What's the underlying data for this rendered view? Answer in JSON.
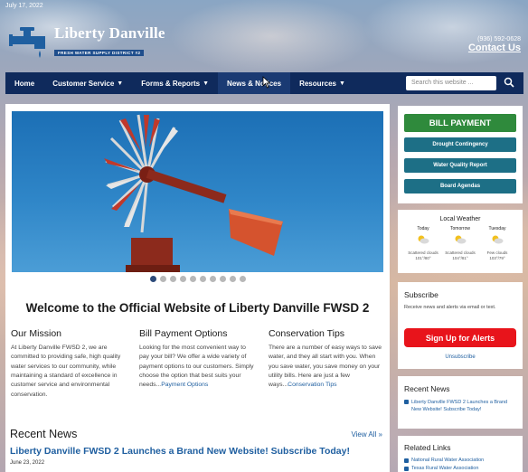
{
  "header": {
    "date": "July 17, 2022",
    "logo_title": "Liberty Danville",
    "logo_subtitle": "FRESH WATER SUPPLY DISTRICT #2",
    "phone": "(936) 592-0628",
    "contact_label": "Contact Us"
  },
  "nav": {
    "items": [
      {
        "label": "Home",
        "dropdown": false
      },
      {
        "label": "Customer Service",
        "dropdown": true
      },
      {
        "label": "Forms & Reports",
        "dropdown": true
      },
      {
        "label": "News & Notices",
        "dropdown": false
      },
      {
        "label": "Resources",
        "dropdown": true
      }
    ],
    "search_placeholder": "Search this website ..."
  },
  "main": {
    "slider_dots": 10,
    "slider_active": 0,
    "welcome": "Welcome to the Official Website of Liberty Danville FWSD 2",
    "columns": [
      {
        "title": "Our Mission",
        "text": "At Liberty Danville FWSD 2, we are committed to providing safe, high quality water services to our community, while maintaining a standard of excellence in customer service and environmental conservation.",
        "link": ""
      },
      {
        "title": "Bill Payment Options",
        "text": "Looking for the most convenient way to pay your bill? We offer a wide variety of payment options to our customers. Simply choose the option that best suits your needs...",
        "link": "Payment Options"
      },
      {
        "title": "Conservation Tips",
        "text": "There are a number of easy ways to save water, and they all start with you. When you save water, you save money on your utility bills. Here are just a few ways...",
        "link": "Conservation Tips"
      }
    ],
    "recent_news": {
      "title": "Recent News",
      "view_all": "View All »",
      "headline": "Liberty Danville FWSD 2 Launches a Brand New Website! Subscribe Today!",
      "date": "June 23, 2022"
    }
  },
  "sidebar": {
    "bill_payment": "BILL PAYMENT",
    "buttons": [
      "Drought Contingency",
      "Water Quality Report",
      "Board Agendas"
    ],
    "weather": {
      "title": "Local Weather",
      "days": [
        {
          "name": "Today",
          "cond": "Scattered clouds",
          "temps": "101°/80°",
          "icon": "partly-cloudy-icon"
        },
        {
          "name": "Tomorrow",
          "cond": "Scattered clouds",
          "temps": "104°/81°",
          "icon": "partly-cloudy-icon"
        },
        {
          "name": "Tuesday",
          "cond": "Few clouds",
          "temps": "103°/79°",
          "icon": "partly-cloudy-icon"
        }
      ]
    },
    "subscribe": {
      "title": "Subscribe",
      "text": "Receive news and alerts via email or text.",
      "button": "Sign Up for Alerts",
      "unsubscribe": "Unsubscribe"
    },
    "recent_news": {
      "title": "Recent News",
      "item": "Liberty Danville FWSD 2 Launches a Brand New Website! Subscribe Today!"
    },
    "related_links": {
      "title": "Related Links",
      "items": [
        "National Rural Water Association",
        "Texas Rural Water Association"
      ]
    }
  },
  "colors": {
    "nav_bg": "#0f2a5c",
    "bill_payment": "#2f8a3c",
    "teal_buttons": "#1d6f86",
    "alerts_button": "#e8141b",
    "link": "#1f5fa0"
  }
}
